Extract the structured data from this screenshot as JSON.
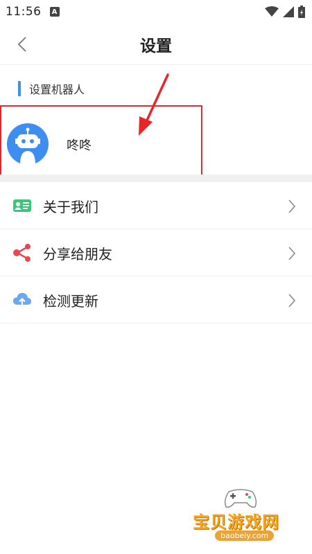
{
  "status_bar": {
    "time": "11:56",
    "a_icon": "A"
  },
  "header": {
    "title": "设置"
  },
  "section": {
    "title": "设置机器人"
  },
  "robot": {
    "name": "咚咚"
  },
  "menu": [
    {
      "label": "关于我们",
      "icon": "id-card-icon"
    },
    {
      "label": "分享给朋友",
      "icon": "share-icon"
    },
    {
      "label": "检测更新",
      "icon": "cloud-upload-icon"
    }
  ],
  "watermark": {
    "title": "宝贝游戏网",
    "url": "baobeiy.com"
  },
  "colors": {
    "accent": "#3d8ef0",
    "highlight": "#e8262a",
    "share": "#e8474c",
    "about": "#3cc57b"
  }
}
